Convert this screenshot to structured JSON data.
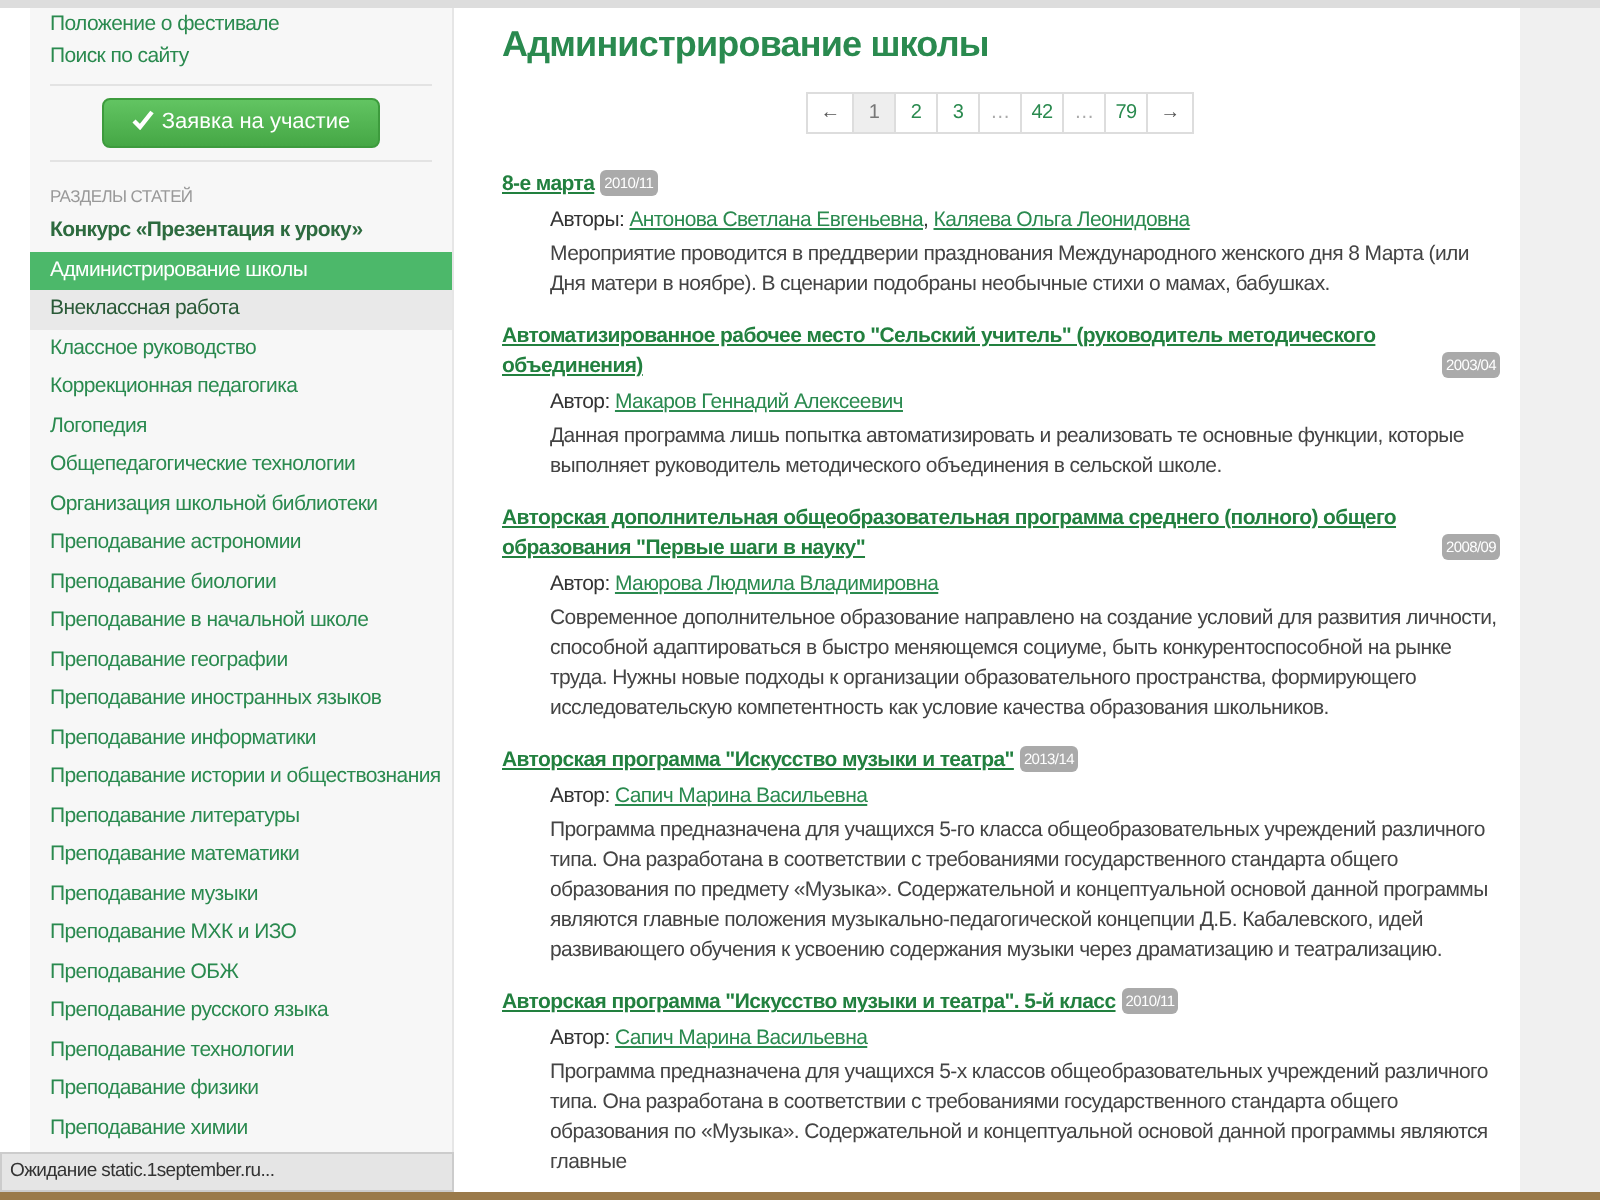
{
  "sidebar": {
    "top_links": [
      "Положение о фестивале",
      "Поиск по сайту"
    ],
    "apply_button": "Заявка на участие",
    "section_heading": "РАЗДЕЛЫ СТАТЕЙ",
    "items": [
      {
        "label": "Конкурс «Презентация к уроку»",
        "kind": "featured",
        "selected": false,
        "hovered": false
      },
      {
        "label": "Администрирование школы",
        "kind": "section",
        "selected": true,
        "hovered": false
      },
      {
        "label": "Внеклассная работа",
        "kind": "section",
        "selected": false,
        "hovered": true
      },
      {
        "label": "Классное руководство",
        "kind": "section",
        "selected": false,
        "hovered": false
      },
      {
        "label": "Коррекционная педагогика",
        "kind": "section",
        "selected": false,
        "hovered": false
      },
      {
        "label": "Логопедия",
        "kind": "section",
        "selected": false,
        "hovered": false
      },
      {
        "label": "Общепедагогические технологии",
        "kind": "section",
        "selected": false,
        "hovered": false
      },
      {
        "label": "Организация школьной библиотеки",
        "kind": "section",
        "selected": false,
        "hovered": false
      },
      {
        "label": "Преподавание астрономии",
        "kind": "section",
        "selected": false,
        "hovered": false
      },
      {
        "label": "Преподавание биологии",
        "kind": "section",
        "selected": false,
        "hovered": false
      },
      {
        "label": "Преподавание в начальной школе",
        "kind": "section",
        "selected": false,
        "hovered": false
      },
      {
        "label": "Преподавание географии",
        "kind": "section",
        "selected": false,
        "hovered": false
      },
      {
        "label": "Преподавание иностранных языков",
        "kind": "section",
        "selected": false,
        "hovered": false
      },
      {
        "label": "Преподавание информатики",
        "kind": "section",
        "selected": false,
        "hovered": false
      },
      {
        "label": "Преподавание истории и обществознания",
        "kind": "section",
        "selected": false,
        "hovered": false
      },
      {
        "label": "Преподавание литературы",
        "kind": "section",
        "selected": false,
        "hovered": false
      },
      {
        "label": "Преподавание математики",
        "kind": "section",
        "selected": false,
        "hovered": false
      },
      {
        "label": "Преподавание музыки",
        "kind": "section",
        "selected": false,
        "hovered": false
      },
      {
        "label": "Преподавание МХК и ИЗО",
        "kind": "section",
        "selected": false,
        "hovered": false
      },
      {
        "label": "Преподавание ОБЖ",
        "kind": "section",
        "selected": false,
        "hovered": false
      },
      {
        "label": "Преподавание русского языка",
        "kind": "section",
        "selected": false,
        "hovered": false
      },
      {
        "label": "Преподавание технологии",
        "kind": "section",
        "selected": false,
        "hovered": false
      },
      {
        "label": "Преподавание физики",
        "kind": "section",
        "selected": false,
        "hovered": false
      },
      {
        "label": "Преподавание химии",
        "kind": "section",
        "selected": false,
        "hovered": false
      }
    ]
  },
  "main": {
    "title": "Администрирование школы",
    "pagination": [
      {
        "label": "←",
        "kind": "arrow",
        "selected": false
      },
      {
        "label": "1",
        "kind": "page",
        "selected": true
      },
      {
        "label": "2",
        "kind": "page",
        "selected": false
      },
      {
        "label": "3",
        "kind": "page",
        "selected": false
      },
      {
        "label": "…",
        "kind": "gap",
        "selected": false
      },
      {
        "label": "42",
        "kind": "page",
        "selected": false
      },
      {
        "label": "…",
        "kind": "gap",
        "selected": false
      },
      {
        "label": "79",
        "kind": "page",
        "selected": false
      },
      {
        "label": "→",
        "kind": "arrow",
        "selected": false
      }
    ],
    "author_separator": ",",
    "articles": [
      {
        "title": "8-е марта",
        "date": "2010/11",
        "author_label": "Авторы:",
        "authors": [
          "Антонова Светлана Евгеньевна",
          "Каляева Ольга Леонидовна"
        ],
        "description": "Мероприятие проводится в преддверии празднования Международного женского дня 8 Марта (или Дня матери в ноябре). В сценарии подобраны необычные стихи о мамах, бабушках."
      },
      {
        "title": "Автоматизированное рабочее место \"Сельский учитель\" (руководитель методического объединения)",
        "date": "2003/04",
        "author_label": "Автор:",
        "authors": [
          "Макаров Геннадий Алексеевич"
        ],
        "description": "Данная программа лишь попытка автоматизировать и реализовать те основные функции, которые выполняет руководитель методического объединения в сельской школе."
      },
      {
        "title": "Авторская дополнительная общеобразовательная программа среднего (полного) общего образования \"Первые шаги в науку\"",
        "date": "2008/09",
        "author_label": "Автор:",
        "authors": [
          "Маюрова Людмила Владимировна"
        ],
        "description": "Современное дополнительное образование направлено на создание условий для развития личности, способной адаптироваться в быстро меняющемся социуме, быть конкурентоспособной на рынке труда. Нужны новые подходы к организации образовательного пространства, формирующего исследовательскую компетентность как условие качества образования школьников."
      },
      {
        "title": "Авторская программа \"Искусство музыки и театра\"",
        "date": "2013/14",
        "author_label": "Автор:",
        "authors": [
          "Сапич Марина Васильевна"
        ],
        "description": "Программа предназначена для учащихся 5-го класса общеобразовательных учреждений различного типа. Она разработана в соответствии с требованиями государственного стандарта общего образования по предмету «Музыка». Содержательной и концептуальной основой данной программы являются главные положения музыкально-педагогической концепции Д.Б. Кабалевского, идей развивающего обучения к усвоению содержания музыки через драматизацию и театрализацию."
      },
      {
        "title": "Авторская программа \"Искусство музыки и театра\". 5-й класс",
        "date": "2010/11",
        "author_label": "Автор:",
        "authors": [
          "Сапич Марина Васильевна"
        ],
        "description": "Программа предназначена для учащихся 5-х классов общеобразовательных учреждений различного типа. Она разработана в соответствии с требованиями государственного стандарта общего образования по «Музыка». Содержательной и концептуальной основой данной программы являются главные"
      }
    ]
  },
  "status_bar": "Ожидание static.1september.ru..."
}
